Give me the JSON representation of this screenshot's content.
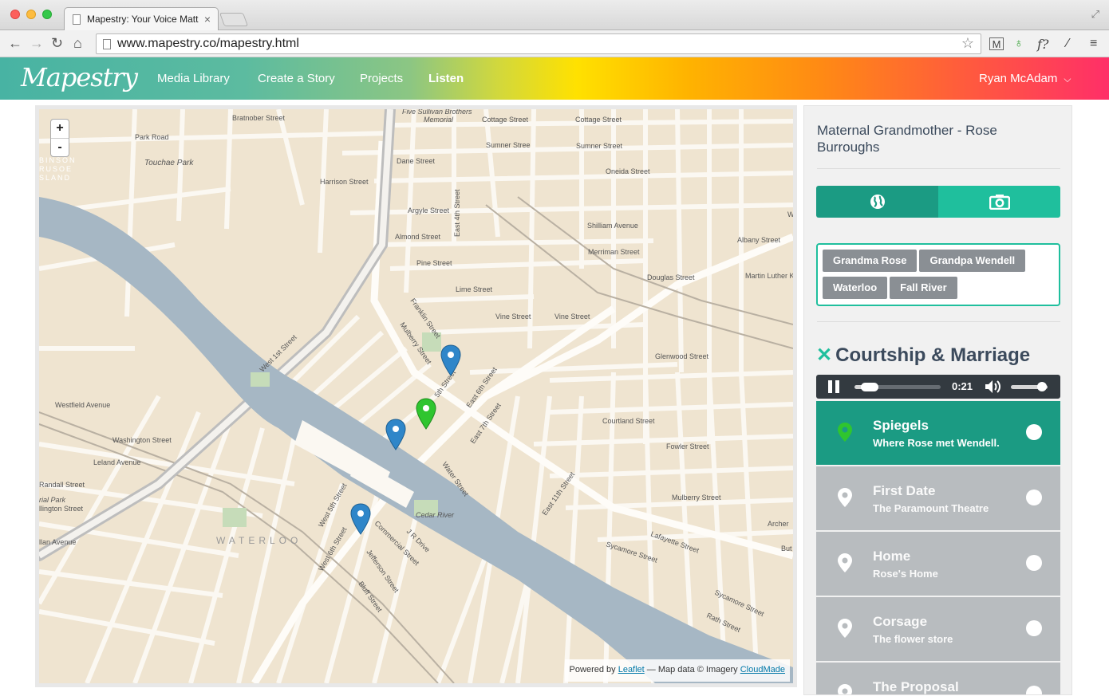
{
  "browser": {
    "tab_title": "Mapestry: Your Voice Matt",
    "tab_close": "×",
    "url": "www.mapestry.co/mapestry.html"
  },
  "header": {
    "logo": "Mapestry",
    "nav": [
      "Media Library",
      "Create a Story",
      "Projects",
      "Listen"
    ],
    "active_nav": "Listen",
    "user": "Ryan McAdam"
  },
  "map": {
    "zoom_in": "+",
    "zoom_out": "-",
    "attribution": {
      "powered_by": "Powered by",
      "leaflet": "Leaflet",
      "map_data": "— Map data © Imagery",
      "cloudmade": "CloudMade"
    },
    "labels": {
      "park_road": "Park Road",
      "touchae_park": "Touchae Park",
      "robinson": "BINSON",
      "crusoe": "RUSOE",
      "island": "SLAND",
      "bratnober": "Bratnober Street",
      "harrison": "Harrison Street",
      "five_sullivan": "Five Sullivan Brothers",
      "memorial": "Memorial",
      "cottage1": "Cottage Street",
      "cottage2": "Cottage Street",
      "sumner1": "Sumner Stree",
      "sumner2": "Sumner Street",
      "dane": "Dane Street",
      "oneida": "Oneida Street",
      "argyle": "Argyle Street",
      "almond": "Almond Street",
      "shilliam": "Shilliam Avenue",
      "albany": "Albany Street",
      "merriman": "Merriman Street",
      "pine": "Pine Street",
      "douglas": "Douglas Street",
      "mlk": "Martin Luther K",
      "lime": "Lime Street",
      "vine1": "Vine Street",
      "vine2": "Vine Street",
      "glenwood": "Glenwood Street",
      "courtland": "Courtland Street",
      "fowler": "Fowler Street",
      "mulberry": "Mulberry Street",
      "westfield": "Westfield Avenue",
      "washington": "Washington Street",
      "leland": "Leland Avenue",
      "randall": "Randall Street",
      "rial_park": "rial Park",
      "ellington": "llington Street",
      "allan_ave": "llan Avenue",
      "waterloo": "WATERLOO",
      "cedar_river": "Cedar River",
      "jr_drive": "J R Drive",
      "lafayette": "Lafayette Street",
      "sycamore": "Sycamore Street",
      "rath": "Rath Street",
      "sycamore2": "Sycamore Street",
      "archer": "Archer",
      "but": "But",
      "west_6th": "West 6th Street",
      "west_1st": "West 1st Street",
      "east_4th": "East 4th Street",
      "franklin": "Franklin Street",
      "mulberry2": "Mulberry Street",
      "fifth": "5th Street",
      "east_6th": "East 6th Street",
      "east_7th": "East 7th Street",
      "water": "Water Street",
      "east_11th": "East 11th Street",
      "commercial": "Commercial Street",
      "jefferson": "Jefferson Street",
      "bluff": "Bluff Street",
      "west_5th": "West 5th Street",
      "w": "W"
    }
  },
  "panel": {
    "story_title": "Maternal Grandmother - Rose Burroughs",
    "tags": [
      "Grandma Rose",
      "Grandpa Wendell",
      "Waterloo",
      "Fall River"
    ],
    "chapter": "Courtship & Marriage",
    "chapter_close": "✕",
    "player": {
      "time": "0:21",
      "progress": 0.18,
      "volume": 0.85
    },
    "stops": [
      {
        "name": "Spiegels",
        "subtitle": "Where Rose met Wendell.",
        "active": true
      },
      {
        "name": "First Date",
        "subtitle": "The Paramount Theatre",
        "active": false
      },
      {
        "name": "Home",
        "subtitle": "Rose's Home",
        "active": false
      },
      {
        "name": "Corsage",
        "subtitle": "The flower store",
        "active": false
      },
      {
        "name": "The Proposal",
        "subtitle": "",
        "active": false
      }
    ]
  },
  "colors": {
    "accent": "#1fbf9d",
    "accent_dark": "#1b9b83",
    "tag": "#8a8f94",
    "inactive_stop": "#b8bcbf",
    "player": "#333a40",
    "map_land": "#efe4d0",
    "map_water": "#a6b7c4",
    "pin_blue": "#2f86c9",
    "pin_green": "#2fc52f"
  }
}
